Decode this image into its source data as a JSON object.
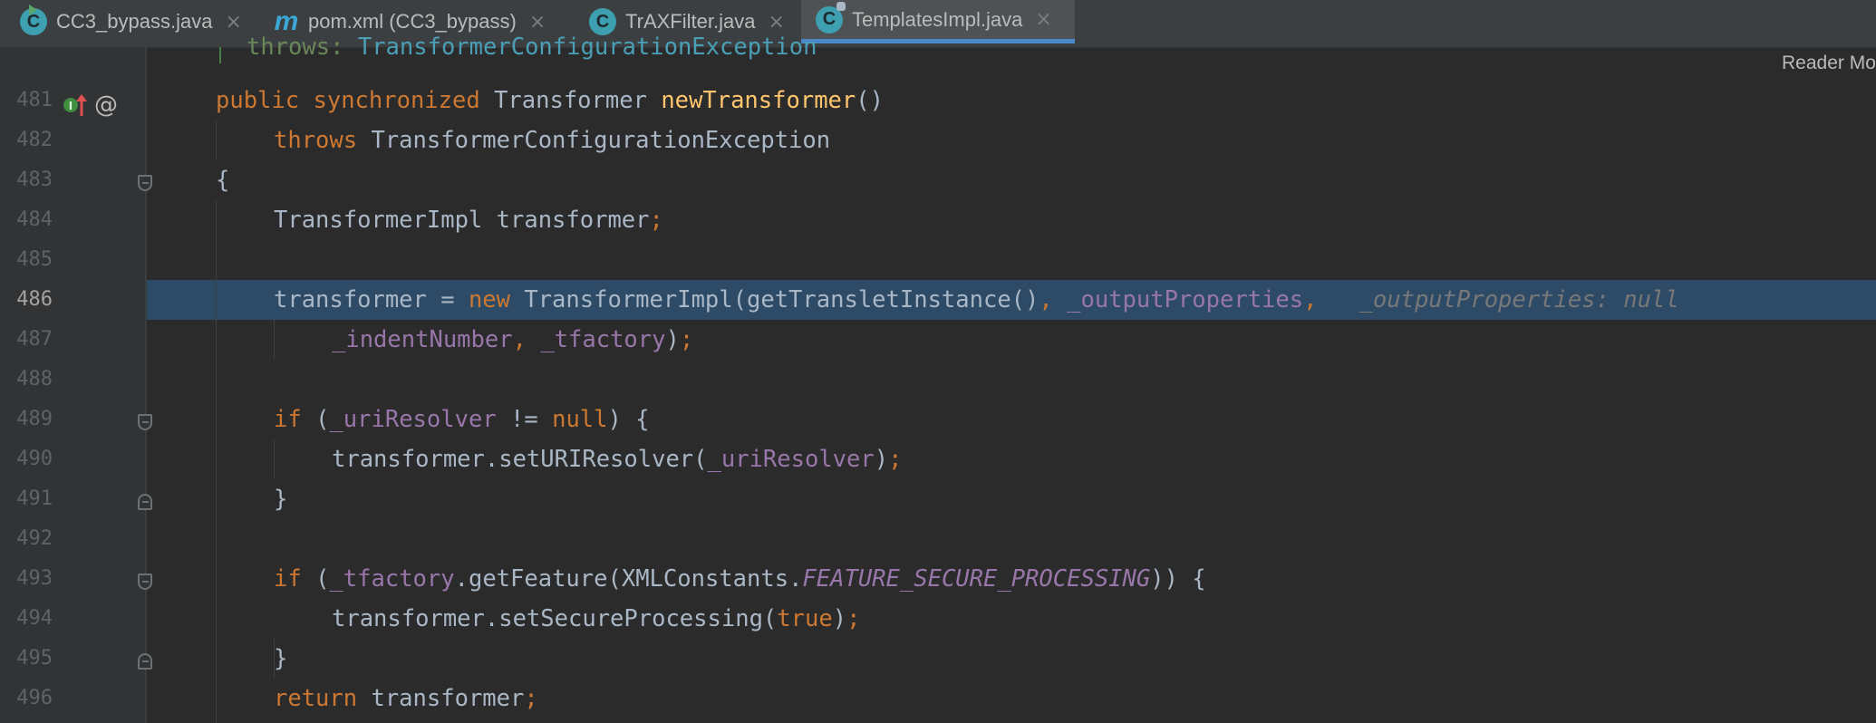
{
  "tabs": [
    {
      "label": "CC3_bypass.java",
      "icon": "java-class-run-icon",
      "active": false
    },
    {
      "label": "pom.xml (CC3_bypass)",
      "icon": "maven-m-icon",
      "active": false
    },
    {
      "label": "TrAXFilter.java",
      "icon": "java-class-icon",
      "active": false
    },
    {
      "label": "TemplatesImpl.java",
      "icon": "java-class-locked-icon",
      "active": true
    }
  ],
  "tab_close_glyph": "×",
  "reader_mode_label": "Reader Mo",
  "gutter": {
    "line_numbers": [
      "481",
      "482",
      "483",
      "484",
      "485",
      "486",
      "487",
      "488",
      "489",
      "490",
      "491",
      "492",
      "493",
      "494",
      "495",
      "496"
    ],
    "current_line": "486",
    "at_glyph": "@"
  },
  "code": {
    "cut_top": {
      "kw": "throws",
      "type": "TransformerConfigurationException"
    },
    "l481": {
      "p1": "public",
      "p2": " ",
      "p3": "synchronized",
      "p4": " Transformer ",
      "p5": "newTransformer",
      "p6": "()"
    },
    "l482": {
      "p1": "throws",
      "p2": " TransformerConfigurationException"
    },
    "l483": {
      "p1": "{"
    },
    "l484": {
      "p1": "TransformerImpl transformer",
      "p2": ";"
    },
    "l486": {
      "p1": "transformer = ",
      "p2": "new",
      "p3": " TransformerImpl(getTransletInstance()",
      "p4": ", ",
      "p5": "_outputProperties",
      "p6": ",",
      "hint": "_outputProperties: null"
    },
    "l487": {
      "p1": "_indentNumber",
      "p2": ", ",
      "p3": "_tfactory",
      "p4": ")",
      "p5": ";"
    },
    "l489": {
      "p1": "if",
      "p2": " (",
      "p3": "_uriResolver",
      "p4": " != ",
      "p5": "null",
      "p6": ") {"
    },
    "l490": {
      "p1": "transformer.setURIResolver(",
      "p2": "_uriResolver",
      "p3": ")",
      "p4": ";"
    },
    "l491": {
      "p1": "}"
    },
    "l493": {
      "p1": "if",
      "p2": " (",
      "p3": "_tfactory",
      "p4": ".getFeature(XMLConstants.",
      "p5": "FEATURE_SECURE_PROCESSING",
      "p6": ")) {"
    },
    "l494": {
      "p1": "transformer.setSecureProcessing(",
      "p2": "true",
      "p3": ")",
      "p4": ";"
    },
    "l495": {
      "p1": "}"
    },
    "l496": {
      "p1": "return",
      "p2": " transformer",
      "p3": ";"
    }
  },
  "colors": {
    "background": "#2b2b2b",
    "keyword": "#cc7832",
    "method_decl": "#ffc66d",
    "field": "#9876aa",
    "default_text": "#a9b7c6",
    "current_line_highlight": "#2d4b66"
  }
}
